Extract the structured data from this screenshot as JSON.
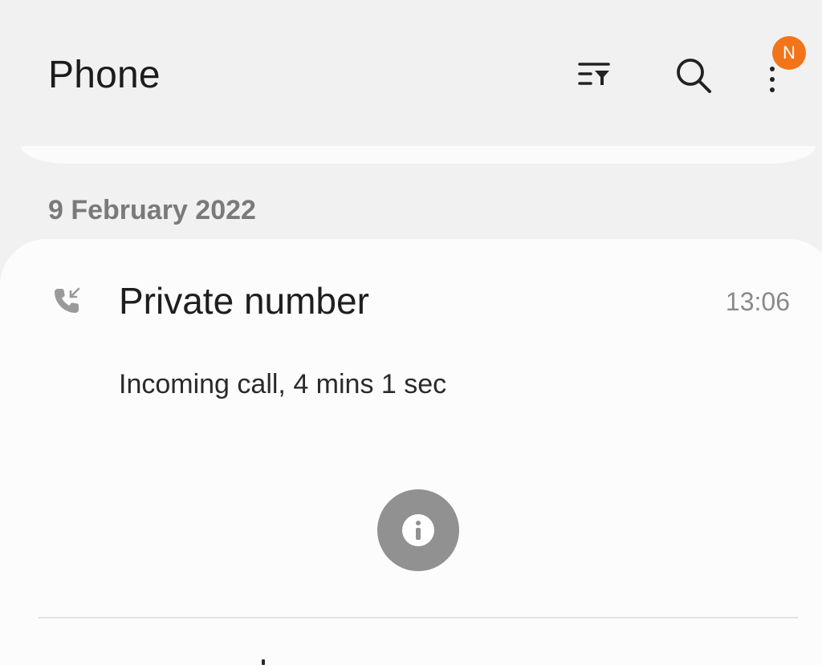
{
  "header": {
    "title": "Phone",
    "notification_badge": "N",
    "badge_color": "#f2741a"
  },
  "toolbar": {
    "filter_icon": "filter-list-icon",
    "search_icon": "search-icon",
    "more_icon": "more-vertical-icon"
  },
  "call_log": {
    "date_header": "9 February 2022",
    "entries": [
      {
        "name": "Private number",
        "time": "13:06",
        "detail": "Incoming call, 4 mins 1 sec",
        "call_type_icon": "incoming-call-icon",
        "action_icon": "info-icon"
      }
    ]
  },
  "colors": {
    "background": "#f1f1f1",
    "card": "#fcfcfc",
    "info_button": "#919191",
    "secondary_text": "#8a8a8a"
  }
}
